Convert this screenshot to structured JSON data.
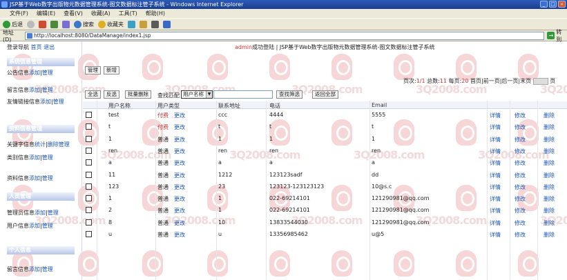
{
  "window": {
    "title": "JSP基于Web数字出版物元数据管理系统-图文数据标注管子系统 - Windows Internet Explorer",
    "watermark": "3Q2008.com"
  },
  "menu": [
    "文件(F)",
    "编辑(E)",
    "查看(V)",
    "收藏(A)",
    "工具(T)",
    "帮助(H)"
  ],
  "toolbar": {
    "back": "后退",
    "search": "搜索",
    "favorites": "收藏夹"
  },
  "address": {
    "label": "地址(D)",
    "url": "http://localhost:8080/DataManage/index1.jsp",
    "go": "转到"
  },
  "sidebar": {
    "top_links": {
      "login": "登录导航",
      "home": "首页",
      "logout": "退出"
    },
    "items": [
      {
        "type": "header",
        "label": "系统信息管理"
      },
      {
        "type": "item",
        "name": "公告信息",
        "add": "添加",
        "manage": "管理"
      },
      {
        "type": "item",
        "name": "留言信息",
        "add": "添加",
        "manage": "管理"
      },
      {
        "type": "item",
        "name": "友情链接信息",
        "add": "添加",
        "manage": "管理"
      },
      {
        "type": "header",
        "label": "资料信息管理"
      },
      {
        "type": "item",
        "name": "关键字信息",
        "add": "统计",
        "manage": "删除管理"
      },
      {
        "type": "item",
        "name": "类别信息",
        "add": "添加",
        "manage": "管理"
      },
      {
        "type": "item",
        "name": "资料信息",
        "add": "添加",
        "manage": "管理"
      },
      {
        "type": "header",
        "label": "人员管理"
      },
      {
        "type": "item",
        "name": "管理员信息",
        "add": "添加",
        "manage": "管理"
      },
      {
        "type": "item",
        "name": "用户信息",
        "add": "添加",
        "manage": "管理"
      },
      {
        "type": "header",
        "label": "个人信息"
      },
      {
        "type": "item",
        "name": "留言信息",
        "add": "添加",
        "manage": "管理"
      }
    ]
  },
  "breadcrumb": {
    "user": "admin",
    "text": "成功登陆 | JSP基于Web数字出版物元数据管理系统-图文数据标注管子系统"
  },
  "actions": {
    "manage": "管理",
    "add": "新增"
  },
  "pager": {
    "prefix": "页次:",
    "current": "1/1",
    "total_label": "总数:",
    "total": "11",
    "per_page_label": "每页:",
    "per_page": "20",
    "nav": "首页|前一页|后一页|末页",
    "suffix": "页"
  },
  "filter": {
    "select_all": "全选",
    "invert": "反选",
    "batch_delete": "批量删除",
    "search_label": "查找匹配",
    "field": "用户名称",
    "search_button": "查找筛选",
    "show_all": "返回全部"
  },
  "table": {
    "columns": [
      "用户名称",
      "用户类型",
      "联系地址",
      "电话",
      "Email"
    ],
    "detail_label": "详情",
    "edit_label": "修改",
    "delete_label": "删除",
    "change_label": "更改",
    "rows": [
      {
        "name": "test",
        "type": "付费",
        "address": "ccc",
        "phone": "4444",
        "email": "5555"
      },
      {
        "name": "t",
        "type": "付费",
        "address": "t",
        "phone": "t",
        "email": "t"
      },
      {
        "name": "1",
        "type": "普通",
        "address": "1",
        "phone": "1",
        "email": "1"
      },
      {
        "name": "ren",
        "type": "普通",
        "address": "ren",
        "phone": "ren",
        "email": "ren"
      },
      {
        "name": "a",
        "type": "普通",
        "address": "a",
        "phone": "a",
        "email": "a"
      },
      {
        "name": "11",
        "type": "普通",
        "address": "1212",
        "phone": "123123sadf",
        "email": "dd"
      },
      {
        "name": "123",
        "type": "普通",
        "address": "23",
        "phone": "123123-123123123",
        "email": "10@s.c"
      },
      {
        "name": "1",
        "type": "普通",
        "address": "1",
        "phone": "022-69214101",
        "email": "121290981@qq.com"
      },
      {
        "name": "2",
        "type": "普通",
        "address": "1",
        "phone": "022-69214101",
        "email": "121290981@qq.com"
      },
      {
        "name": "8",
        "type": "普通",
        "address": "10",
        "phone": "13833544030",
        "email": "121290981@qq.com"
      },
      {
        "name": "u",
        "type": "普通",
        "address": "u",
        "phone": "13356985462",
        "email": "u@5"
      }
    ]
  },
  "colors": {
    "accent_red": "#d03030",
    "link_blue": "#1a56b8",
    "title_blue": "#2c5ab9"
  }
}
